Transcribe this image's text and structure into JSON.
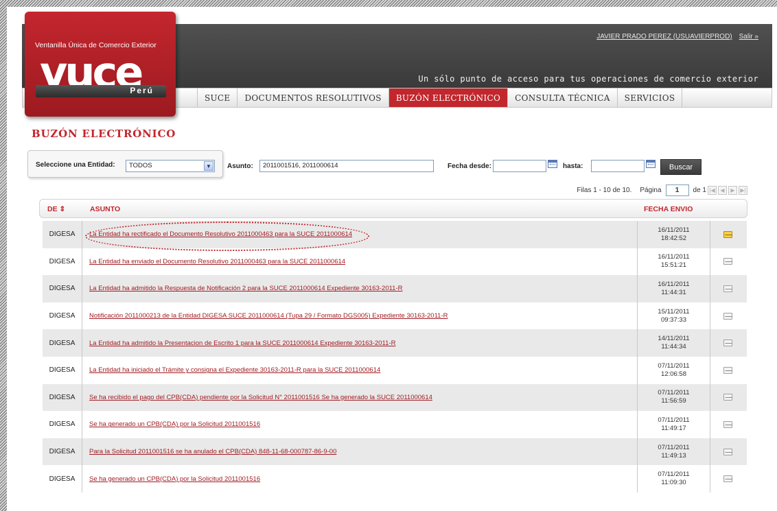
{
  "header": {
    "user_link": "JAVIER PRADO PEREZ (USUAVIERPROD)",
    "logout_link": "Salir »",
    "slogan": "Un sólo punto de acceso para tus operaciones de comercio exterior"
  },
  "logo": {
    "subtitle": "Ventanilla Única de Comercio Exterior",
    "main": "vuce",
    "country": "Perú"
  },
  "nav": [
    {
      "label": "SUCE",
      "active": false
    },
    {
      "label": "DOCUMENTOS RESOLUTIVOS",
      "active": false
    },
    {
      "label": "BUZÓN ELECTRÓNICO",
      "active": true
    },
    {
      "label": "CONSULTA TÉCNICA",
      "active": false
    },
    {
      "label": "SERVICIOS",
      "active": false
    }
  ],
  "page_title": "BUZÓN ELECTRÓNICO",
  "filters": {
    "entity_label": "Seleccione una Entidad:",
    "entity_value": "TODOS",
    "asunto_label": "Asunto:",
    "asunto_value": "2011001516, 2011000614",
    "fecha_desde_label": "Fecha desde:",
    "fecha_desde_value": "",
    "hasta_label": "hasta:",
    "hasta_value": "",
    "search_button": "Buscar"
  },
  "pager": {
    "rows_text": "Filas 1 - 10 de 10.",
    "page_label": "Página",
    "page_value": "1",
    "of_text": "de 1"
  },
  "table": {
    "headers": {
      "de": "DE ⇕",
      "asunto": "ASUNTO",
      "fecha": "FECHA ENVIO"
    },
    "rows": [
      {
        "de": "DIGESA",
        "asunto": "La Entidad ha rectificado el Documento Resolutivo 2011000463 para la SUCE 2011000614",
        "date": "16/11/2011",
        "time": "18:42:52",
        "icon": "envelope-unread-icon"
      },
      {
        "de": "DIGESA",
        "asunto": "La Entidad ha enviado el Documento Resolutivo 2011000463 para la SUCE 2011000614",
        "date": "16/11/2011",
        "time": "15:51:21",
        "icon": "envelope-read-icon"
      },
      {
        "de": "DIGESA",
        "asunto": "La Entidad ha admitido la Respuesta de Notificación 2 para la SUCE 2011000614 Expediente 30163-2011-R",
        "date": "16/11/2011",
        "time": "11:44:31",
        "icon": "envelope-read-icon"
      },
      {
        "de": "DIGESA",
        "asunto": "Notificación 2011000213 de la Entidad DIGESA SUCE 2011000614 (Tupa 29 / Formato DGS005) Expediente 30163-2011-R",
        "date": "15/11/2011",
        "time": "09:37:33",
        "icon": "envelope-read-icon"
      },
      {
        "de": "DIGESA",
        "asunto": "La Entidad ha admitido la Presentacion de Escrito 1 para la SUCE 2011000614 Expediente 30163-2011-R",
        "date": "14/11/2011",
        "time": "11:44:34",
        "icon": "envelope-read-icon"
      },
      {
        "de": "DIGESA",
        "asunto": "La Entidad ha iniciado el Trámite y consigna el Expediente 30163-2011-R para la SUCE 2011000614",
        "date": "07/11/2011",
        "time": "12:06:58",
        "icon": "envelope-read-icon"
      },
      {
        "de": "DIGESA",
        "asunto": "Se ha recibido el pago del CPB(CDA) pendiente por la Solicitud N° 2011001516 Se ha generado la SUCE 2011000614",
        "date": "07/11/2011",
        "time": "11:56:59",
        "icon": "envelope-read-icon"
      },
      {
        "de": "DIGESA",
        "asunto": "Se ha generado un CPB(CDA) por la Solicitud 2011001516",
        "date": "07/11/2011",
        "time": "11:49:17",
        "icon": "envelope-read-icon"
      },
      {
        "de": "DIGESA",
        "asunto": "Para la Solicitud 2011001516 se ha anulado el CPB(CDA) 848-11-68-000787-86-9-00",
        "date": "07/11/2011",
        "time": "11:49:13",
        "icon": "envelope-read-icon"
      },
      {
        "de": "DIGESA",
        "asunto": "Se ha generado un CPB(CDA) por la Solicitud 2011001516",
        "date": "07/11/2011",
        "time": "11:09:30",
        "icon": "envelope-read-icon"
      }
    ]
  },
  "colors": {
    "brand_red": "#c1272d",
    "link_red": "#a01c22",
    "header_dark": "#444444"
  }
}
